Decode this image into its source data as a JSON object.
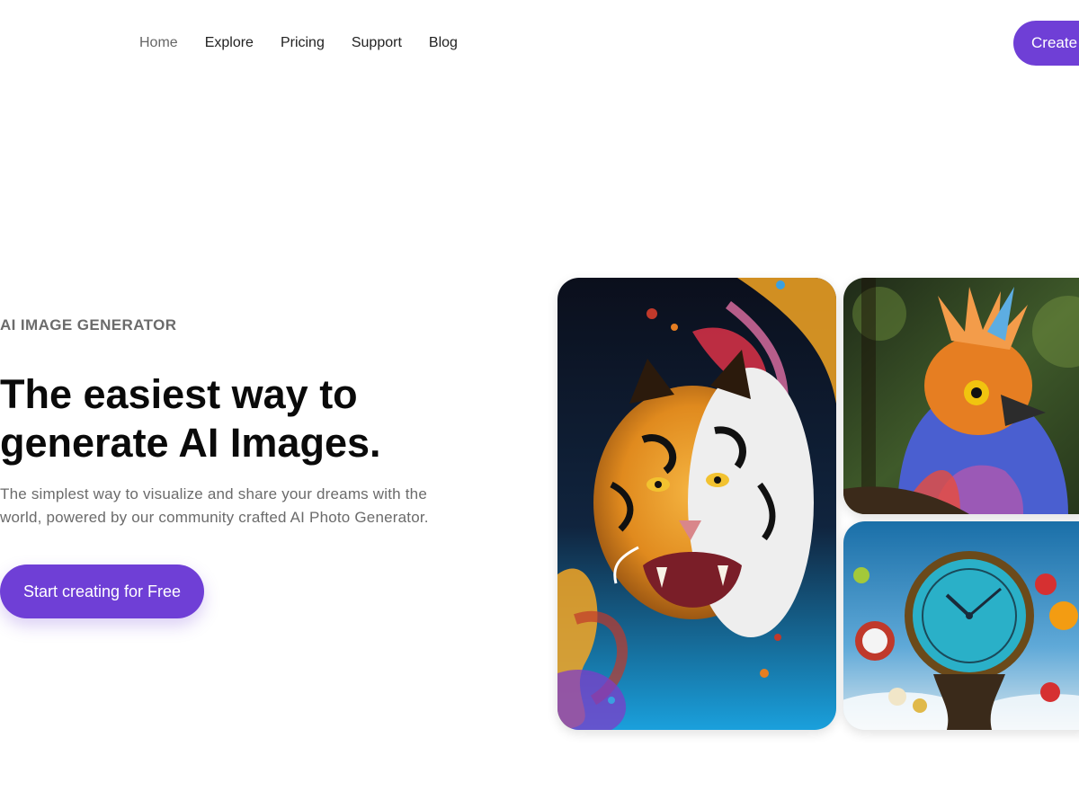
{
  "nav": {
    "items": [
      {
        "label": "Home",
        "active": true
      },
      {
        "label": "Explore"
      },
      {
        "label": "Pricing"
      },
      {
        "label": "Support"
      },
      {
        "label": "Blog"
      }
    ],
    "cta_label": "Create"
  },
  "hero": {
    "eyebrow": "AI IMAGE GENERATOR",
    "headline_line1": "The easiest way to",
    "headline_line2": "generate AI Images.",
    "subtext_line1": "The simplest way to visualize and share your dreams with the",
    "subtext_line2": "world, powered by our community crafted AI Photo Generator.",
    "cta_label": "Start creating for Free"
  },
  "colors": {
    "accent": "#6f3fd6",
    "muted_text": "#6b6b6b",
    "heading": "#0a0a0a"
  },
  "gallery": {
    "images": [
      {
        "subject": "tiger with colorful paint splash"
      },
      {
        "subject": "colorful feathered bird in forest"
      },
      {
        "subject": "melting clock with floating apples"
      }
    ]
  }
}
